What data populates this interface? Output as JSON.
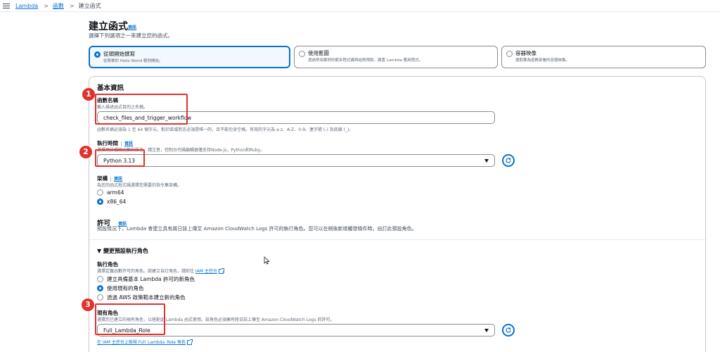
{
  "breadcrumb": {
    "root": "Lambda",
    "parent": "函數",
    "current": "建立函式"
  },
  "page": {
    "title": "建立函式",
    "info": "資訊",
    "subtitle": "選擇下列選項之一來建立您的函式。"
  },
  "options": [
    {
      "title": "從頭開始撰寫",
      "desc": "從簡單的 Hello World 範例開始。",
      "selected": true
    },
    {
      "title": "使用藍圖",
      "desc": "透過常用案例的範本程式碼與組態預設，建置 Lambda 應用程式。",
      "selected": false
    },
    {
      "title": "容器映像",
      "desc": "選取要為函數部署的容器映像。",
      "selected": false
    }
  ],
  "basic": {
    "heading": "基本資訊",
    "fn_name_label": "函數名稱",
    "fn_name_desc": "輸入描述函式目的之名稱。",
    "fn_name_value": "check_files_and_trigger_workflow",
    "fn_name_hint": "函數名稱必須為 1 至 64 個字元，對於區域而言必須是唯一的，且不能包含空格。有效的字元為 a-z、A-Z、0-9、連字號 (-) 及底線 (_)。",
    "runtime_label": "執行時間",
    "runtime_info": "資訊",
    "runtime_desc": "選擇用於撰寫函數的語言。請注意，控制台代碼編輯器僅支持Node.js，Python和Ruby。",
    "runtime_value": "Python 3.13",
    "arch_label": "架構",
    "arch_info": "資訊",
    "arch_desc": "為您的函式程式碼選擇您需要的指令集架構。",
    "arch_options": [
      "arm64",
      "x86_64"
    ],
    "arch_selected": "x86_64"
  },
  "permissions": {
    "heading": "許可",
    "info": "資訊",
    "desc": "預設情況下，Lambda 會建立具有將日誌上傳至 Amazon CloudWatch Logs 許可的執行角色。您可以在稍後新增觸發條件時，自訂此預設角色。"
  },
  "role_section": {
    "toggle_label": "▼ 變更預設執行角色",
    "exec_role_label": "執行角色",
    "exec_role_desc_prefix": "選擇定義函數許可的角色。欲建立自訂角色，請前往 ",
    "exec_role_desc_link": "IAM 主控台",
    "exec_role_desc_suffix": "。",
    "role_options": [
      "建立具備基本 Lambda 許可的新角色",
      "使用現有的角色",
      "透過 AWS 政策範本建立新的角色"
    ],
    "role_selected": "使用現有的角色",
    "existing_label": "現有角色",
    "existing_desc": "選擇您已建立的現有角色，以搭配此 Lambda 函式使用。該角色必須擁有將日誌上傳至 Amazon CloudWatch Logs 的許可。",
    "existing_value": "Full_Lambda_Role",
    "iam_link": "在 IAM 主控台上檢視 Full_Lambda_Role 角色"
  },
  "annotations": [
    "1",
    "2",
    "3"
  ],
  "colors": {
    "accent": "#0972d3",
    "highlight": "#e0312d",
    "selected_tile_bg": "#f2f8fd"
  }
}
